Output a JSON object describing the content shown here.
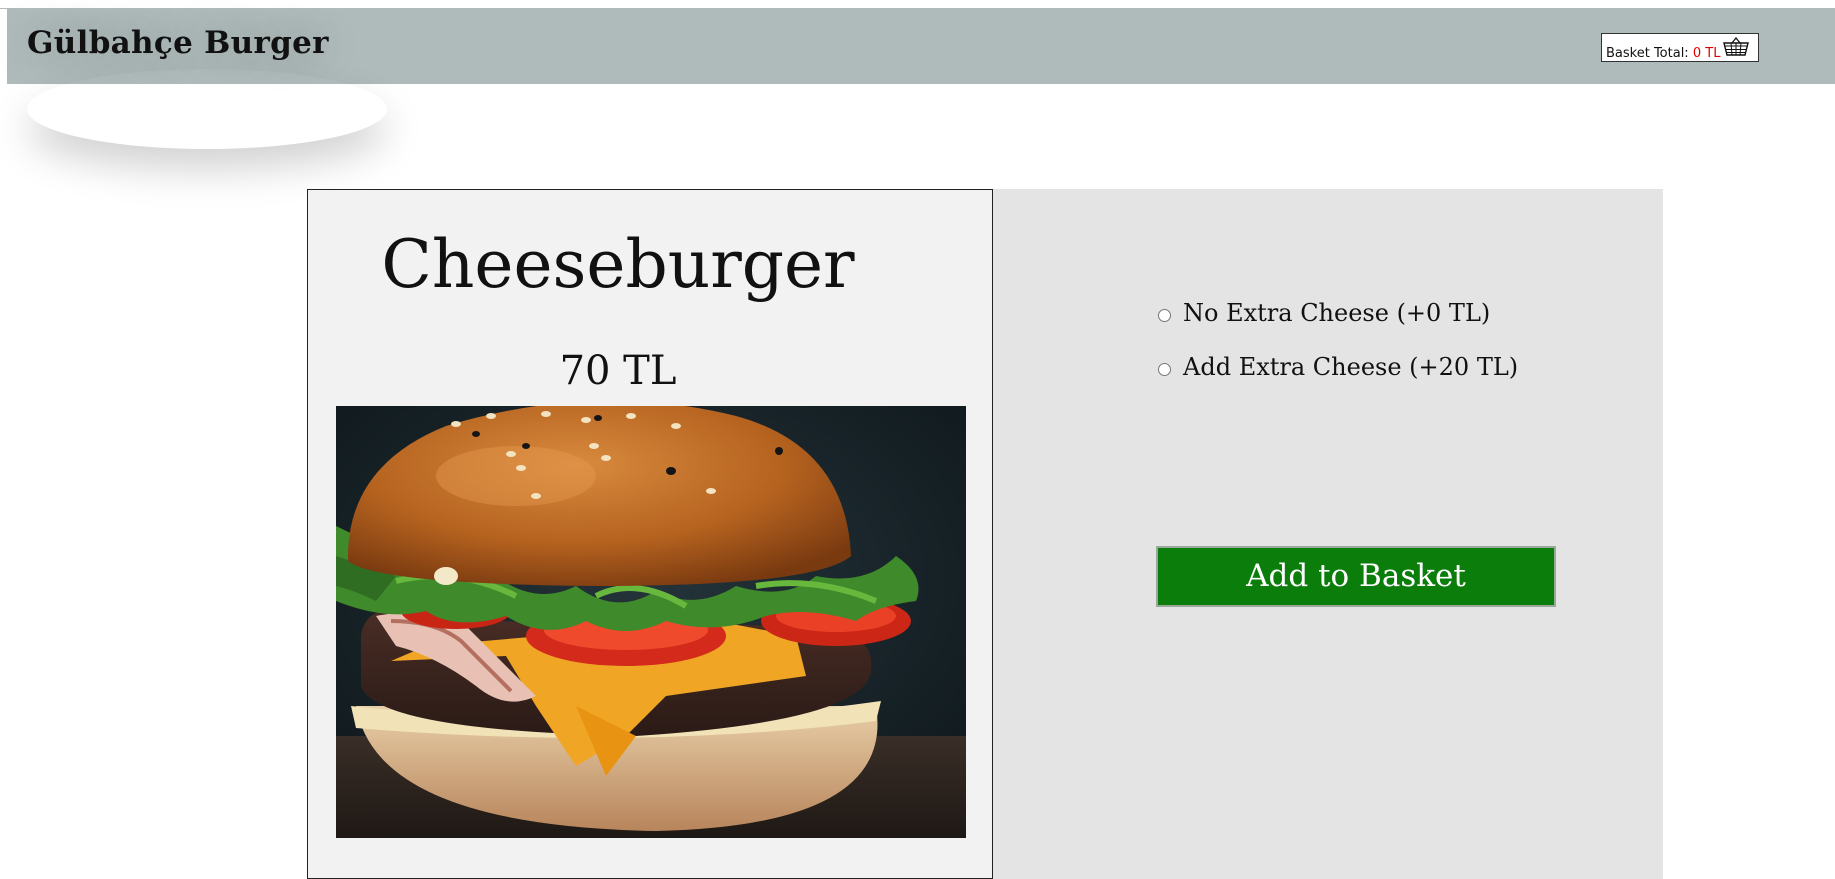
{
  "header": {
    "brand": "Gülbahçe Burger",
    "basket_label": "Basket Total:",
    "basket_amount": "0 TL",
    "basket_icon": "basket-icon"
  },
  "product": {
    "name": "Cheeseburger",
    "price": "70 TL",
    "image": "cheeseburger-photo"
  },
  "options": [
    {
      "label": "No Extra Cheese (+0 TL)",
      "selected": false
    },
    {
      "label": "Add Extra Cheese (+20 TL)",
      "selected": false
    }
  ],
  "actions": {
    "add_to_basket": "Add to Basket"
  },
  "colors": {
    "header_bg": "#afbbbb",
    "button_bg": "#0a7d0a",
    "basket_amount": "#e00000",
    "left_card_bg": "#f2f2f2",
    "right_card_bg": "#e4e4e4"
  }
}
